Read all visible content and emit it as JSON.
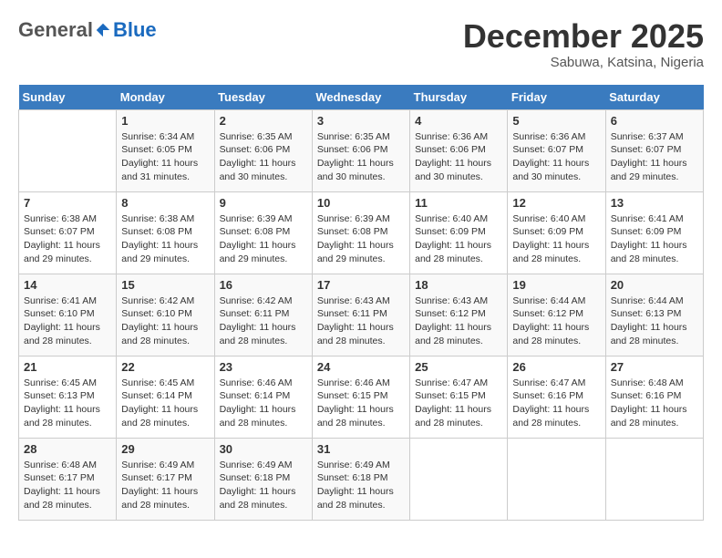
{
  "header": {
    "logo_general": "General",
    "logo_blue": "Blue",
    "month_title": "December 2025",
    "location": "Sabuwa, Katsina, Nigeria"
  },
  "weekdays": [
    "Sunday",
    "Monday",
    "Tuesday",
    "Wednesday",
    "Thursday",
    "Friday",
    "Saturday"
  ],
  "weeks": [
    [
      {
        "day": "",
        "info": ""
      },
      {
        "day": "1",
        "info": "Sunrise: 6:34 AM\nSunset: 6:05 PM\nDaylight: 11 hours and 31 minutes."
      },
      {
        "day": "2",
        "info": "Sunrise: 6:35 AM\nSunset: 6:06 PM\nDaylight: 11 hours and 30 minutes."
      },
      {
        "day": "3",
        "info": "Sunrise: 6:35 AM\nSunset: 6:06 PM\nDaylight: 11 hours and 30 minutes."
      },
      {
        "day": "4",
        "info": "Sunrise: 6:36 AM\nSunset: 6:06 PM\nDaylight: 11 hours and 30 minutes."
      },
      {
        "day": "5",
        "info": "Sunrise: 6:36 AM\nSunset: 6:07 PM\nDaylight: 11 hours and 30 minutes."
      },
      {
        "day": "6",
        "info": "Sunrise: 6:37 AM\nSunset: 6:07 PM\nDaylight: 11 hours and 29 minutes."
      }
    ],
    [
      {
        "day": "7",
        "info": "Sunrise: 6:38 AM\nSunset: 6:07 PM\nDaylight: 11 hours and 29 minutes."
      },
      {
        "day": "8",
        "info": "Sunrise: 6:38 AM\nSunset: 6:08 PM\nDaylight: 11 hours and 29 minutes."
      },
      {
        "day": "9",
        "info": "Sunrise: 6:39 AM\nSunset: 6:08 PM\nDaylight: 11 hours and 29 minutes."
      },
      {
        "day": "10",
        "info": "Sunrise: 6:39 AM\nSunset: 6:08 PM\nDaylight: 11 hours and 29 minutes."
      },
      {
        "day": "11",
        "info": "Sunrise: 6:40 AM\nSunset: 6:09 PM\nDaylight: 11 hours and 28 minutes."
      },
      {
        "day": "12",
        "info": "Sunrise: 6:40 AM\nSunset: 6:09 PM\nDaylight: 11 hours and 28 minutes."
      },
      {
        "day": "13",
        "info": "Sunrise: 6:41 AM\nSunset: 6:09 PM\nDaylight: 11 hours and 28 minutes."
      }
    ],
    [
      {
        "day": "14",
        "info": "Sunrise: 6:41 AM\nSunset: 6:10 PM\nDaylight: 11 hours and 28 minutes."
      },
      {
        "day": "15",
        "info": "Sunrise: 6:42 AM\nSunset: 6:10 PM\nDaylight: 11 hours and 28 minutes."
      },
      {
        "day": "16",
        "info": "Sunrise: 6:42 AM\nSunset: 6:11 PM\nDaylight: 11 hours and 28 minutes."
      },
      {
        "day": "17",
        "info": "Sunrise: 6:43 AM\nSunset: 6:11 PM\nDaylight: 11 hours and 28 minutes."
      },
      {
        "day": "18",
        "info": "Sunrise: 6:43 AM\nSunset: 6:12 PM\nDaylight: 11 hours and 28 minutes."
      },
      {
        "day": "19",
        "info": "Sunrise: 6:44 AM\nSunset: 6:12 PM\nDaylight: 11 hours and 28 minutes."
      },
      {
        "day": "20",
        "info": "Sunrise: 6:44 AM\nSunset: 6:13 PM\nDaylight: 11 hours and 28 minutes."
      }
    ],
    [
      {
        "day": "21",
        "info": "Sunrise: 6:45 AM\nSunset: 6:13 PM\nDaylight: 11 hours and 28 minutes."
      },
      {
        "day": "22",
        "info": "Sunrise: 6:45 AM\nSunset: 6:14 PM\nDaylight: 11 hours and 28 minutes."
      },
      {
        "day": "23",
        "info": "Sunrise: 6:46 AM\nSunset: 6:14 PM\nDaylight: 11 hours and 28 minutes."
      },
      {
        "day": "24",
        "info": "Sunrise: 6:46 AM\nSunset: 6:15 PM\nDaylight: 11 hours and 28 minutes."
      },
      {
        "day": "25",
        "info": "Sunrise: 6:47 AM\nSunset: 6:15 PM\nDaylight: 11 hours and 28 minutes."
      },
      {
        "day": "26",
        "info": "Sunrise: 6:47 AM\nSunset: 6:16 PM\nDaylight: 11 hours and 28 minutes."
      },
      {
        "day": "27",
        "info": "Sunrise: 6:48 AM\nSunset: 6:16 PM\nDaylight: 11 hours and 28 minutes."
      }
    ],
    [
      {
        "day": "28",
        "info": "Sunrise: 6:48 AM\nSunset: 6:17 PM\nDaylight: 11 hours and 28 minutes."
      },
      {
        "day": "29",
        "info": "Sunrise: 6:49 AM\nSunset: 6:17 PM\nDaylight: 11 hours and 28 minutes."
      },
      {
        "day": "30",
        "info": "Sunrise: 6:49 AM\nSunset: 6:18 PM\nDaylight: 11 hours and 28 minutes."
      },
      {
        "day": "31",
        "info": "Sunrise: 6:49 AM\nSunset: 6:18 PM\nDaylight: 11 hours and 28 minutes."
      },
      {
        "day": "",
        "info": ""
      },
      {
        "day": "",
        "info": ""
      },
      {
        "day": "",
        "info": ""
      }
    ]
  ]
}
